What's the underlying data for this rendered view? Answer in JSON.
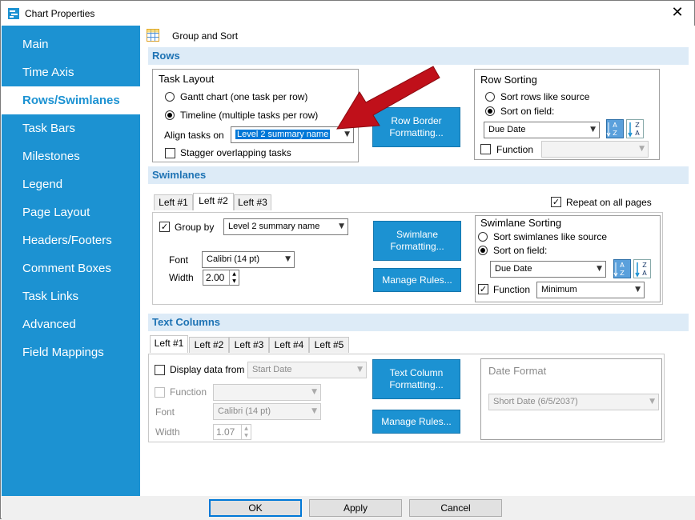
{
  "window": {
    "title": "Chart Properties",
    "close_glyph": "✕"
  },
  "sidebar": {
    "items": [
      {
        "label": "Main"
      },
      {
        "label": "Time Axis"
      },
      {
        "label": "Rows/Swimlanes"
      },
      {
        "label": "Task Bars"
      },
      {
        "label": "Milestones"
      },
      {
        "label": "Legend"
      },
      {
        "label": "Page Layout"
      },
      {
        "label": "Headers/Footers"
      },
      {
        "label": "Comment Boxes"
      },
      {
        "label": "Task Links"
      },
      {
        "label": "Advanced"
      },
      {
        "label": "Field Mappings"
      }
    ],
    "active": "Rows/Swimlanes"
  },
  "toolbar": {
    "label": "Group and Sort"
  },
  "rows": {
    "heading": "Rows",
    "task_layout": {
      "title": "Task Layout",
      "option_gantt": "Gantt chart (one task per row)",
      "option_timeline": "Timeline (multiple tasks per row)",
      "align_label": "Align tasks on",
      "align_value": "Level 2 summary name",
      "stagger_label": "Stagger overlapping tasks"
    },
    "row_border_button": "Row Border Formatting...",
    "row_sorting": {
      "title": "Row Sorting",
      "option_source": "Sort rows like source",
      "option_field": "Sort on field:",
      "field_value": "Due Date",
      "function_label": "Function",
      "function_value": ""
    }
  },
  "swimlanes": {
    "heading": "Swimlanes",
    "tabs": [
      "Left #1",
      "Left #2",
      "Left #3"
    ],
    "active_tab": "Left #2",
    "repeat_label": "Repeat on all pages",
    "group_by_label": "Group by",
    "group_by_value": "Level 2 summary name",
    "font_label": "Font",
    "font_value": "Calibri (14 pt)",
    "width_label": "Width",
    "width_value": "2.00",
    "format_button": "Swimlane Formatting...",
    "manage_button": "Manage Rules...",
    "sorting": {
      "title": "Swimlane Sorting",
      "option_source": "Sort swimlanes like source",
      "option_field": "Sort on field:",
      "field_value": "Due Date",
      "function_label": "Function",
      "function_value": "Minimum"
    }
  },
  "text_columns": {
    "heading": "Text Columns",
    "tabs": [
      "Left #1",
      "Left #2",
      "Left #3",
      "Left #4",
      "Left #5"
    ],
    "active_tab": "Left #1",
    "display_label": "Display data from",
    "display_value": "Start Date",
    "function_label": "Function",
    "function_value": "",
    "font_label": "Font",
    "font_value": "Calibri (14 pt)",
    "width_label": "Width",
    "width_value": "1.07",
    "format_button": "Text Column Formatting...",
    "manage_button": "Manage Rules...",
    "date_format_title": "Date Format",
    "date_format_value": "Short Date (6/5/2037)"
  },
  "footer": {
    "ok": "OK",
    "apply": "Apply",
    "cancel": "Cancel"
  },
  "colors": {
    "accent": "#1c92d2",
    "section_bg": "#ddebf7",
    "section_text": "#1e73b4",
    "annotation_arrow": "#c0101a"
  },
  "annotation": {
    "shape": "arrow-icon",
    "points_to": "align-tasks-combo"
  }
}
